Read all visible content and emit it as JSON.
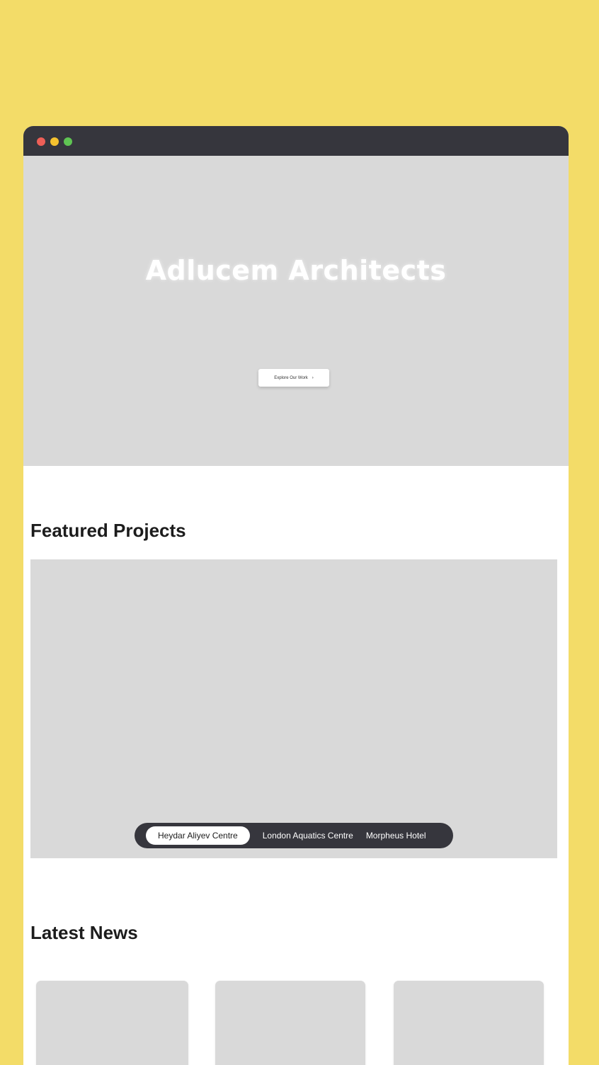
{
  "window": {
    "controls": [
      "close",
      "minimize",
      "maximize"
    ]
  },
  "hero": {
    "title": "Adlucem Architects",
    "subtitle": "",
    "button_label": "Explore Our Work",
    "button_icon": "arrow-right-icon"
  },
  "featured": {
    "title": "Featured  Projects",
    "tabs": [
      {
        "label": "Heydar Aliyev Centre",
        "active": true
      },
      {
        "label": "London Aquatics Centre",
        "active": false
      },
      {
        "label": "Morpheus Hotel",
        "active": false
      }
    ]
  },
  "news": {
    "title": "Latest News",
    "card_count": 3
  },
  "colors": {
    "page_background": "#f3dc68",
    "titlebar": "#36363d",
    "placeholder": "#d9d9d9",
    "close_dot": "#ee5f57",
    "minimize_dot": "#f5c22f",
    "maximize_dot": "#5fc453"
  }
}
